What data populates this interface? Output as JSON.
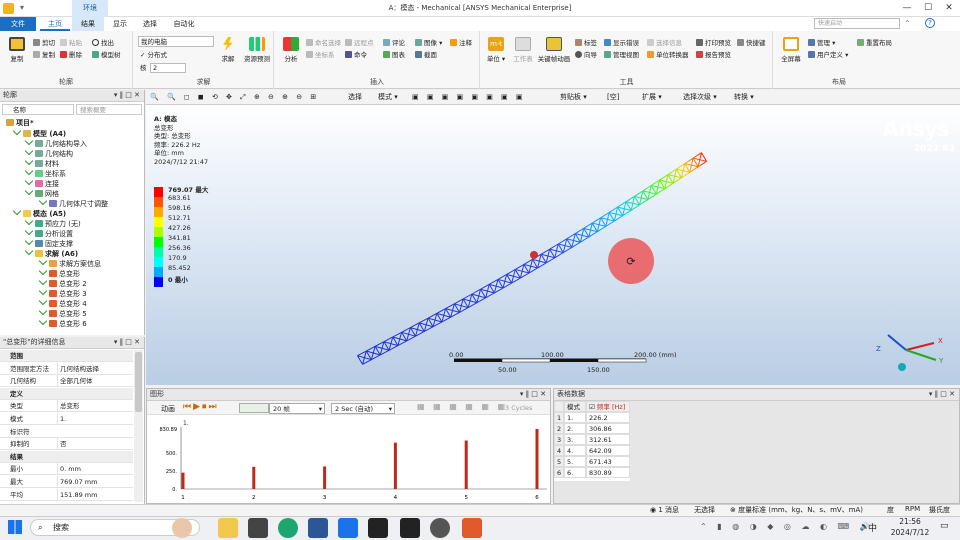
{
  "window": {
    "context_tab": "环境",
    "title": "A：模态 - Mechanical [ANSYS Mechanical Enterprise]",
    "search_placeholder": "快速启动"
  },
  "ribbon_tabs": [
    "文件",
    "主页",
    "结果",
    "显示",
    "选择",
    "自动化"
  ],
  "ribbon": {
    "outline_group": {
      "label": "轮廓",
      "copy": "复制",
      "cut": "剪切",
      "copy2": "复制",
      "paste": "粘贴",
      "delete": "删除",
      "find": "找出",
      "tree": "模型树"
    },
    "solve_group": {
      "label": "求解",
      "computer": "我的电脑",
      "distributed": "分布式",
      "cores_label": "核",
      "cores": "2",
      "solve": "求解",
      "resources": "资源预测"
    },
    "insert_group": {
      "label": "插入",
      "analysis": "分析",
      "named_sel": "命名选择",
      "coord": "坐标系",
      "remote": "远程点",
      "command": "命令",
      "comment": "评论",
      "chart": "图表",
      "image": "图像",
      "annotation": "注释",
      "section": "截面"
    },
    "tools_group": {
      "label": "工具",
      "units": "单位",
      "worksheet": "工作表",
      "keyframe": "关键帧动画",
      "tags": "标签",
      "wizard": "向导",
      "show_errors": "显示错误",
      "manage_views": "管理视图",
      "select_info": "选择信息",
      "unit_converter": "单位转换器",
      "print_preview": "打印预览",
      "report_preview": "报告预览",
      "shortcuts": "快捷键"
    },
    "layout_group": {
      "label": "布局",
      "fullscreen": "全屏幕",
      "manage": "管理",
      "user_defined": "用户定义",
      "reset_layout": "重置布局"
    }
  },
  "outline": {
    "title": "轮廓",
    "name_col": "名称",
    "search_placeholder": "搜索概要",
    "items": [
      "项目*",
      "模型 (A4)",
      "几何结构导入",
      "几何结构",
      "材料",
      "坐标系",
      "连接",
      "网格",
      "几何体尺寸调整",
      "模态 (A5)",
      "预应力 (无)",
      "分析设置",
      "固定支撑",
      "求解 (A6)",
      "求解方案信息",
      "总变形",
      "总变形 2",
      "总变形 3",
      "总变形 4",
      "总变形 5",
      "总变形 6"
    ]
  },
  "details": {
    "title": "\"总变形\"的详细信息",
    "rows": [
      {
        "k": "范围",
        "section": true
      },
      {
        "k": "范围限定方法",
        "v": "几何结构选择"
      },
      {
        "k": "几何结构",
        "v": "全部几何体"
      },
      {
        "k": "定义",
        "section": true
      },
      {
        "k": "类型",
        "v": "总变形"
      },
      {
        "k": "模式",
        "v": "1."
      },
      {
        "k": "标识符",
        "v": ""
      },
      {
        "k": "抑制的",
        "v": "否"
      },
      {
        "k": "结果",
        "section": true
      },
      {
        "k": "最小",
        "v": "0. mm"
      },
      {
        "k": "最大",
        "v": "769.07 mm"
      },
      {
        "k": "平均",
        "v": "151.89 mm"
      }
    ]
  },
  "viewport_toolbar": [
    "选择",
    "模式",
    "剪贴板",
    "[空]",
    "扩展",
    "选择次级",
    "转换"
  ],
  "result": {
    "header": [
      "A: 模态",
      "总变形",
      "类型: 总变形",
      "频率: 226.2  Hz",
      "单位: mm",
      "2024/7/12 21:47"
    ],
    "legend_values": [
      "769.07 最大",
      "683.61",
      "598.16",
      "512.71",
      "427.26",
      "341.81",
      "256.36",
      "170.9",
      "85.452",
      "0 最小"
    ],
    "legend_colors": [
      "#ff0000",
      "#ff5500",
      "#ffaa00",
      "#ffff00",
      "#aaff00",
      "#00ff00",
      "#00ffaa",
      "#00ffff",
      "#00aaff",
      "#0000ff"
    ],
    "scale_labels": [
      "0.00",
      "100.00",
      "200.00 (mm)",
      "50.00",
      "150.00"
    ],
    "brand": "Ansys",
    "version": "2022 R1",
    "axes": [
      "Z",
      "X",
      "Y"
    ]
  },
  "graph": {
    "title": "图形",
    "animation": "动画",
    "frames": "20 帧",
    "duration": "2 Sec (自动)",
    "cycles": "3 Cycles",
    "chart_data": {
      "type": "bar",
      "categories": [
        "1",
        "2",
        "3",
        "4",
        "5",
        "6"
      ],
      "values": [
        226.2,
        306.86,
        312.61,
        642.09,
        671.43,
        830.89
      ],
      "ylim": [
        0,
        830.89
      ],
      "yticks": [
        "830.89",
        "500.",
        "250.",
        "0."
      ],
      "title": "1."
    }
  },
  "table": {
    "title": "表格数据",
    "columns": [
      "模式",
      "频率 [Hz]"
    ],
    "rows": [
      [
        "1",
        "1.",
        "226.2"
      ],
      [
        "2",
        "2.",
        "306.86"
      ],
      [
        "3",
        "3.",
        "312.61"
      ],
      [
        "4",
        "4.",
        "642.09"
      ],
      [
        "5",
        "5.",
        "671.43"
      ],
      [
        "6",
        "6.",
        "830.89"
      ]
    ]
  },
  "status": {
    "messages": "1 消息",
    "selection": "无选择",
    "units": "度量标准 (mm、kg、N、s、mV、mA)",
    "angle": "度",
    "rpm": "RPM",
    "temp": "摄氏度"
  },
  "taskbar": {
    "search": "搜索",
    "lang": "中",
    "time": "21:56",
    "date": "2024/7/12"
  },
  "colors": {
    "accent": "#1b6ec2",
    "bar": "#c0281c"
  }
}
